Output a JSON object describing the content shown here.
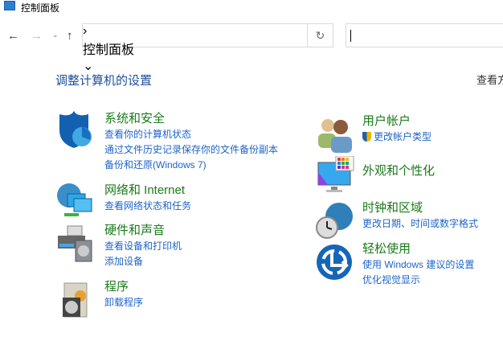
{
  "window": {
    "title": "控制面板"
  },
  "address": {
    "path": "控制面板",
    "search_value": ""
  },
  "main": {
    "heading": "调整计算机的设置",
    "view_by": "查看方式"
  },
  "categories": [
    {
      "title": "系统和安全",
      "links": [
        "查看你的计算机状态",
        "通过文件历史记录保存你的文件备份副本",
        "备份和还原(Windows 7)"
      ]
    },
    {
      "title": "网络和 Internet",
      "links": [
        "查看网络状态和任务"
      ]
    },
    {
      "title": "硬件和声音",
      "links": [
        "查看设备和打印机",
        "添加设备"
      ]
    },
    {
      "title": "程序",
      "links": [
        "卸载程序"
      ]
    },
    {
      "title": "用户帐户",
      "links": [
        "更改帐户类型"
      ]
    },
    {
      "title": "外观和个性化",
      "links": []
    },
    {
      "title": "时钟和区域",
      "links": [
        "更改日期、时间或数字格式"
      ]
    },
    {
      "title": "轻松使用",
      "links": [
        "使用 Windows 建议的设置",
        "优化视觉显示"
      ]
    }
  ]
}
